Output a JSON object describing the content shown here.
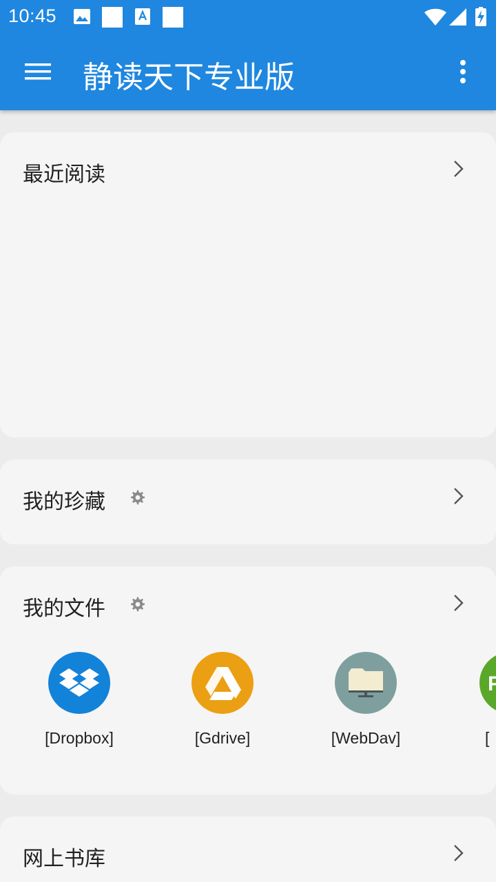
{
  "status_bar": {
    "time": "10:45",
    "left_icons": [
      "image-icon",
      "blank-notification-icon",
      "font-icon",
      "blank-notification-icon"
    ],
    "right_icons": [
      "wifi-icon",
      "signal-icon",
      "battery-charging-icon"
    ]
  },
  "app_bar": {
    "title": "静读天下专业版",
    "menu_icon": "hamburger-menu-icon",
    "more_icon": "more-vert-icon",
    "color": "#1f87df"
  },
  "sections": {
    "recent": {
      "title": "最近阅读"
    },
    "favorites": {
      "title": "我的珍藏"
    },
    "files": {
      "title": "我的文件",
      "items": [
        {
          "label": "[Dropbox]",
          "icon": "dropbox-icon",
          "color": "#1382d9"
        },
        {
          "label": "[Gdrive]",
          "icon": "google-drive-icon",
          "color": "#eb9f12"
        },
        {
          "label": "[WebDav]",
          "icon": "webdav-folder-icon",
          "color": "#7f9f9f"
        },
        {
          "label": "[",
          "icon": "ftp-icon",
          "color": "#5aa829"
        }
      ]
    },
    "online": {
      "title": "网上书库"
    }
  }
}
